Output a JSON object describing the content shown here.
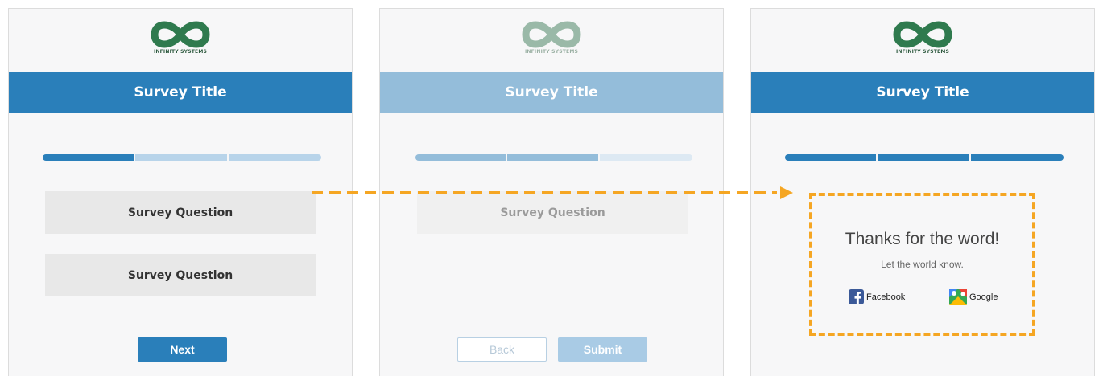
{
  "colors": {
    "primary": "#2a7fba",
    "primary_faded": "#94bdda",
    "progress_inactive": "#b8d4ea",
    "progress_inactive_faded": "#dde9f3",
    "question_bg": "#e8e8e8",
    "question_bg_faded": "#f0f0f0",
    "arrow": "#f5a623",
    "logo_green": "#2f7a4e",
    "logo_green_faded": "#9ab9a8"
  },
  "panels": [
    {
      "logo_text": "INFINITY SYSTEMS",
      "title": "Survey Title",
      "progress_filled_segments": 1,
      "progress_total_segments": 3,
      "questions": [
        "Survey Question",
        "Survey Question"
      ],
      "next_label": "Next"
    },
    {
      "logo_text": "INFINITY SYSTEMS",
      "title": "Survey Title",
      "progress_filled_segments": 2,
      "progress_total_segments": 3,
      "questions": [
        "Survey Question"
      ],
      "back_label": "Back",
      "submit_label": "Submit"
    },
    {
      "logo_text": "INFINITY SYSTEMS",
      "title": "Survey Title",
      "progress_filled_segments": 3,
      "progress_total_segments": 3,
      "thanks": {
        "heading": "Thanks for the word!",
        "subheading": "Let the world know.",
        "facebook_label": "Facebook",
        "google_label": "Google"
      }
    }
  ],
  "icons": {
    "logo": "infinity-logo-icon",
    "facebook": "facebook-icon",
    "google": "google-maps-icon",
    "arrow": "dashed-arrow-icon"
  }
}
